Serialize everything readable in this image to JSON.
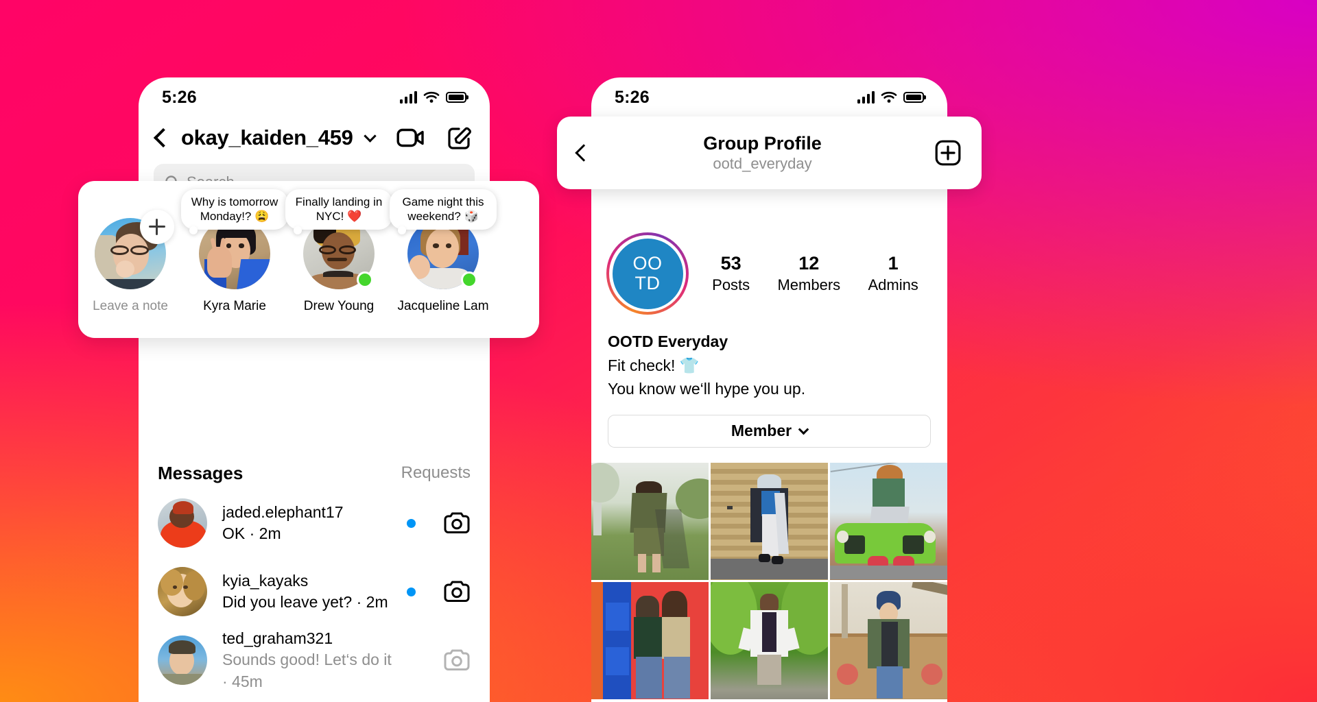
{
  "background": {
    "colors": [
      "#ff0466",
      "#d800c4",
      "#fd2c38",
      "#fe8a1a"
    ]
  },
  "left_phone": {
    "status": {
      "time": "5:26",
      "signal_icon": "signal-bars-icon",
      "wifi_icon": "wifi-icon",
      "battery_icon": "battery-full-icon"
    },
    "header": {
      "back_icon": "chevron-left-icon",
      "username": "okay_kaiden_459",
      "dropdown_icon": "chevron-down-icon",
      "video_icon": "video-camera-icon",
      "compose_icon": "compose-icon"
    },
    "search": {
      "placeholder": "Search",
      "icon": "search-icon"
    },
    "notes": {
      "items": [
        {
          "label": "Leave a note",
          "note": "",
          "muted": true,
          "plus": true,
          "online": false
        },
        {
          "label": "Kyra Marie",
          "note": "Why is tomorrow Monday!? 😩",
          "muted": false,
          "plus": false,
          "online": false
        },
        {
          "label": "Drew Young",
          "note": "Finally landing in NYC! ❤️",
          "muted": false,
          "plus": false,
          "online": true
        },
        {
          "label": "Jacqueline Lam",
          "note": "Game night this weekend? 🎲",
          "muted": false,
          "plus": false,
          "online": true
        }
      ]
    },
    "messages": {
      "title": "Messages",
      "requests_label": "Requests",
      "threads": [
        {
          "name": "jaded.elephant17",
          "preview": "OK · 2m",
          "unread": true,
          "muted": false,
          "camera_icon": "camera-icon"
        },
        {
          "name": "kyia_kayaks",
          "preview": "Did you leave yet? · 2m",
          "unread": true,
          "muted": false,
          "camera_icon": "camera-icon"
        },
        {
          "name": "ted_graham321",
          "preview": "Sounds good! Let‘s do it · 45m",
          "unread": false,
          "muted": true,
          "camera_icon": "camera-icon"
        }
      ]
    }
  },
  "right_phone": {
    "status": {
      "time": "5:26",
      "signal_icon": "signal-bars-icon",
      "wifi_icon": "wifi-icon",
      "battery_icon": "battery-full-icon"
    },
    "header": {
      "back_icon": "chevron-left-icon",
      "title": "Group Profile",
      "subtitle": "ootd_everyday",
      "add_icon": "add-member-icon"
    },
    "avatar": {
      "line1": "OO",
      "line2": "TD",
      "color": "#1f86c4"
    },
    "stats": [
      {
        "value": "53",
        "label": "Posts"
      },
      {
        "value": "12",
        "label": "Members"
      },
      {
        "value": "1",
        "label": "Admins"
      }
    ],
    "bio": {
      "name": "OOTD Everyday",
      "line1": "Fit check! 👕",
      "line2": "You know we‘ll hype you up."
    },
    "member_button": {
      "label": "Member",
      "chevron_icon": "chevron-down-icon"
    },
    "grid": [
      {
        "alt": "person-in-olive-suit-outdoors"
      },
      {
        "alt": "person-in-long-coat-by-garage-door"
      },
      {
        "alt": "person-sitting-on-green-jeep"
      },
      {
        "alt": "two-people-against-red-wall"
      },
      {
        "alt": "person-in-white-blazer-by-ivy"
      },
      {
        "alt": "person-in-beanie-by-fence"
      }
    ]
  }
}
